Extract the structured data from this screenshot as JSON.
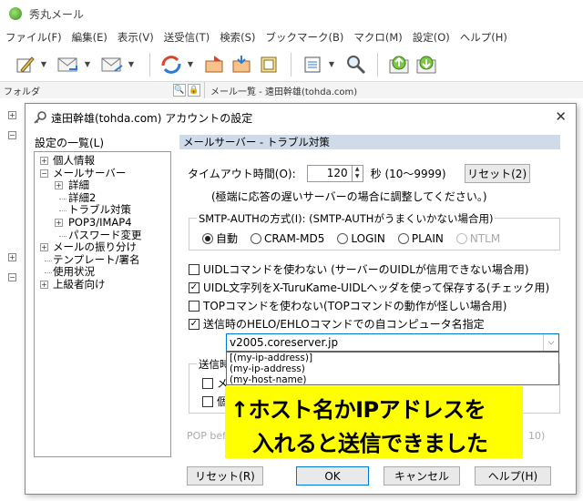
{
  "app": {
    "title": "秀丸メール"
  },
  "menu": [
    "ファイル(F)",
    "編集(E)",
    "表示(V)",
    "送受信(T)",
    "検索(S)",
    "ブックマーク(B)",
    "マクロ(M)",
    "設定(O)",
    "ヘルプ(H)"
  ],
  "toolbar": {
    "arrow": "▼"
  },
  "folder_bar": {
    "label": "フォルダ",
    "search_glyph": "🔍",
    "lock_glyph": "🔒"
  },
  "list_bar": {
    "label": "メール一覧 - 遠田幹雄(tohda.com)"
  },
  "dialog": {
    "title": "遠田幹雄(tohda.com) アカウントの設定",
    "close": "✕",
    "settings_label": "設定の一覧(L)",
    "tree": [
      {
        "label": "個人情報"
      },
      {
        "label": "メールサーバー"
      },
      {
        "label": "詳細"
      },
      {
        "label": "詳細2"
      },
      {
        "label": "トラブル対策"
      },
      {
        "label": "POP3/IMAP4"
      },
      {
        "label": "パスワード変更"
      },
      {
        "label": "メールの振り分け"
      },
      {
        "label": "テンプレート/署名"
      },
      {
        "label": "使用状況"
      },
      {
        "label": "上級者向け"
      }
    ],
    "panel_header": "メールサーバー - トラブル対策",
    "timeout": {
      "label": "タイムアウト時間(O):",
      "value": "120",
      "unit": "秒 (10〜9999)",
      "reset": "リセット(2)",
      "note": "(極端に応答の遅いサーバーの場合に調整してください。)"
    },
    "smtp_auth": {
      "label": "SMTP-AUTHの方式(I): (SMTP-AUTHがうまくいかない場合用)",
      "options": [
        "自動",
        "CRAM-MD5",
        "LOGIN",
        "PLAIN",
        "NTLM"
      ]
    },
    "checks": [
      {
        "label": "UIDLコマンドを使わない (サーバーのUIDLが信用できない場合用)",
        "checked": false
      },
      {
        "label": "UIDL文字列をX-TuruKame-UIDLヘッダを使って保存する(チェック用)",
        "checked": true
      },
      {
        "label": "TOPコマンドを使わない(TOPコマンドの動作が怪しい場合用)",
        "checked": false
      },
      {
        "label": "送信時のHELO/EHLOコマンドでの自コンピュータ名指定",
        "checked": true
      }
    ],
    "check_mark": "✓",
    "hostname": {
      "value": "v2005.coreserver.jp",
      "dd_glyph": "⌵",
      "options": [
        "[(my-ip-address)]",
        "(my-ip-address)",
        "(my-host-name)"
      ]
    },
    "hidden_group": {
      "label": "送信時",
      "row1": "メ",
      "row2": "個"
    },
    "pop_before": {
      "label": "POP bef",
      "suffix": "10)"
    },
    "buttons": {
      "reset": "リセット(R)",
      "ok": "OK",
      "cancel": "キャンセル",
      "help": "ヘルプ(H)"
    }
  },
  "callout": {
    "line1": "↑ホスト名かIPアドレスを",
    "line2": "入れると送信できました",
    "color": "#ffff00"
  },
  "colors": {
    "panel_header": "#cfdbe9",
    "combo_border": "#0078d7"
  }
}
